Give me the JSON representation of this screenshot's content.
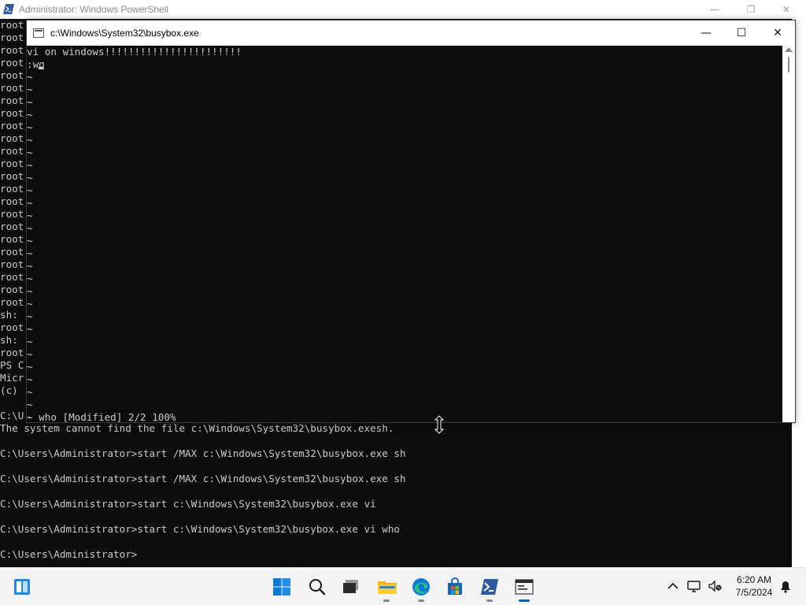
{
  "powershell": {
    "title": "Administrator: Windows PowerShell",
    "controls": {
      "minimize": "—",
      "maximize": "❐",
      "close": "✕"
    },
    "left_column": [
      "root",
      "root",
      "root",
      "root",
      "root",
      "root",
      "root",
      "root",
      "root",
      "root",
      "root",
      "root",
      "root",
      "root",
      "root",
      "root",
      "root",
      "root",
      "root",
      "root",
      "root",
      "root",
      "root",
      "sh:",
      "root",
      "sh:",
      "root",
      "PS C",
      "Micr",
      "(c)",
      "",
      "C:\\U"
    ],
    "lines": [
      "The system cannot find the file c:\\Windows\\System32\\busybox.exesh.",
      "",
      "C:\\Users\\Administrator>start /MAX c:\\Windows\\System32\\busybox.exe sh",
      "",
      "C:\\Users\\Administrator>start /MAX c:\\Windows\\System32\\busybox.exe sh",
      "",
      "C:\\Users\\Administrator>start c:\\Windows\\System32\\busybox.exe vi",
      "",
      "C:\\Users\\Administrator>start c:\\Windows\\System32\\busybox.exe vi who",
      "",
      "C:\\Users\\Administrator>"
    ]
  },
  "busybox": {
    "title": "c:\\Windows\\System32\\busybox.exe",
    "controls": {
      "minimize": "—",
      "maximize": "☐",
      "close": "✕"
    },
    "vi": {
      "lines": [
        "vi on windows!!!!!!!!!!!!!!!!!!!!!!!",
        ":wq"
      ],
      "tilde": "~",
      "tilde_count": 28,
      "status_line": "- who [Modified] 2/2 100%"
    }
  },
  "taskbar": {
    "items": [
      {
        "name": "widgets-icon"
      },
      {
        "name": "start-icon"
      },
      {
        "name": "search-icon"
      },
      {
        "name": "task-view-icon"
      },
      {
        "name": "file-explorer-icon"
      },
      {
        "name": "edge-icon"
      },
      {
        "name": "store-icon"
      },
      {
        "name": "powershell-icon"
      },
      {
        "name": "console-icon"
      }
    ],
    "clock": {
      "time": "6:20 AM",
      "date": "7/5/2024"
    }
  }
}
